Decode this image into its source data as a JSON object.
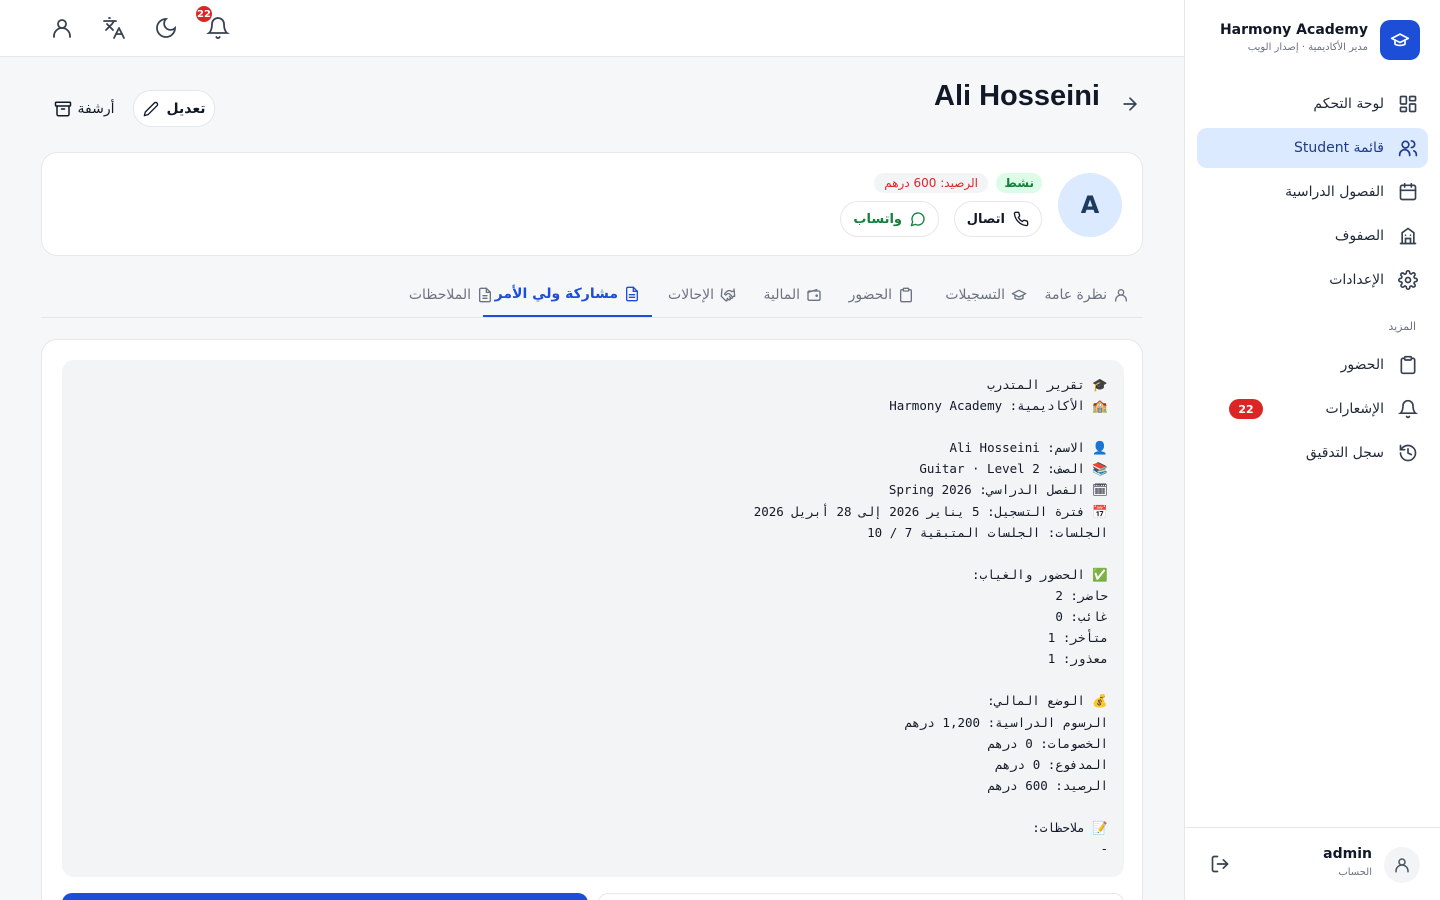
{
  "brand": {
    "name": "Harmony Academy",
    "subtitle": "مدير الأكاديمية · إصدار الويب",
    "accent": "#1d4ed8"
  },
  "sidebar": {
    "items": [
      {
        "label": "لوحة التحكم",
        "icon": "dashboard-icon"
      },
      {
        "label": "قائمة Student",
        "icon": "users-icon",
        "active": true
      },
      {
        "label": "الفصول الدراسية",
        "icon": "calendar-icon"
      },
      {
        "label": "الصفوف",
        "icon": "building-icon"
      },
      {
        "label": "الإعدادات",
        "icon": "gear-icon"
      }
    ],
    "section_more": "المزيد",
    "more_items": [
      {
        "label": "الحضور",
        "icon": "clipboard-icon"
      },
      {
        "label": "الإشعارات",
        "icon": "bell-icon",
        "badge": "22"
      },
      {
        "label": "سجل التدقيق",
        "icon": "history-icon"
      }
    ]
  },
  "account": {
    "name": "admin",
    "role": "الحساب"
  },
  "topbar": {
    "notification_count": "22"
  },
  "header": {
    "title": "Ali Hosseini",
    "edit_label": "تعديل",
    "archive_label": "أرشفة"
  },
  "profile": {
    "avatar_letter": "A",
    "status": "نشط",
    "balance": "الرصيد: 600 درهم",
    "call_label": "اتصال",
    "whatsapp_label": "واتساب"
  },
  "tabs": [
    {
      "label": "نظرة عامة",
      "icon": "user-icon"
    },
    {
      "label": "التسجيلات",
      "icon": "graduation-cap-icon"
    },
    {
      "label": "الحضور",
      "icon": "clipboard-icon"
    },
    {
      "label": "المالية",
      "icon": "wallet-icon"
    },
    {
      "label": "الإحالات",
      "icon": "handshake-icon"
    },
    {
      "label": "مشاركة ولي الأمر",
      "icon": "file-text-icon",
      "active": true
    },
    {
      "label": "الملاحظات",
      "icon": "notes-icon"
    }
  ],
  "report": {
    "lines": [
      "🎓 تقرير المتدرب",
      "🏫 الأكاديمية: Harmony Academy",
      "",
      "👤 الاسم: Ali Hosseini",
      "📚 الصف: Guitar · Level 2",
      "🗓 الفصل الدراسي: Spring 2026",
      "📅 فترة التسجيل: 5 يناير 2026 إلى 28 أبريل 2026",
      "الجلسات: الجلسات المتبقية 7 / 10",
      "",
      "✅ الحضور والغياب:",
      "حاضر: 2",
      "غائب: 0",
      "متأخر: 1",
      "معذور: 1",
      "",
      "💰 الوضع المالي:",
      "الرسوم الدراسية: 1,200 درهم",
      "الخصومات: 0 درهم",
      "المدفوع: 0 درهم",
      "الرصيد: 600 درهم",
      "",
      "📝 ملاحظات:",
      "-"
    ]
  }
}
